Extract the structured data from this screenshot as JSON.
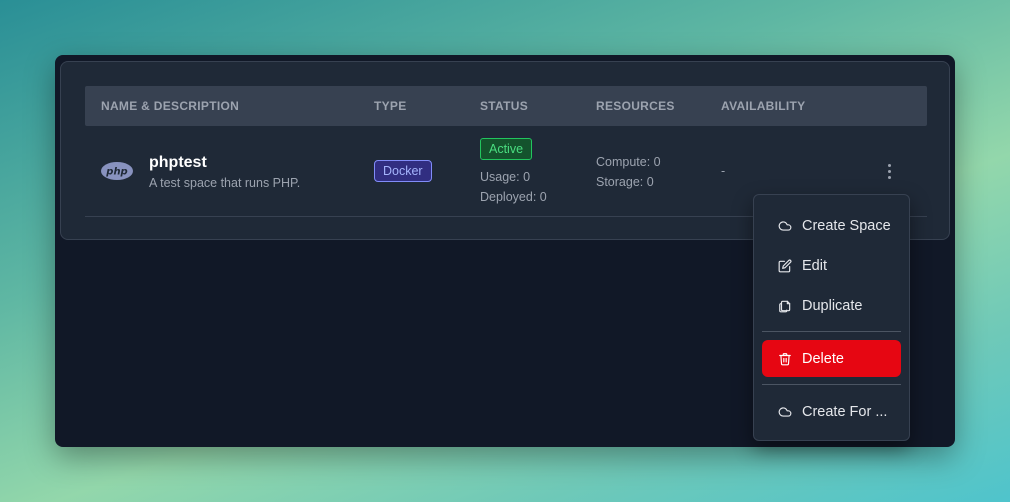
{
  "table": {
    "columns": [
      "NAME & DESCRIPTION",
      "TYPE",
      "STATUS",
      "RESOURCES",
      "AVAILABILITY"
    ],
    "rows": [
      {
        "logo_text": "php",
        "name": "phptest",
        "description": "A test space that runs PHP.",
        "type": "Docker",
        "status": "Active",
        "usage": "Usage: 0",
        "deployed": "Deployed: 0",
        "compute": "Compute: 0",
        "storage": "Storage: 0",
        "availability": "-"
      }
    ]
  },
  "context_menu": {
    "items": [
      {
        "label": "Create Space",
        "icon": "cloud-icon"
      },
      {
        "label": "Edit",
        "icon": "edit-icon"
      },
      {
        "label": "Duplicate",
        "icon": "copy-icon"
      },
      {
        "label": "Delete",
        "icon": "trash-icon",
        "danger": true
      },
      {
        "label": "Create For ...",
        "icon": "cloud-icon"
      }
    ]
  },
  "colors": {
    "window_bg": "#111827",
    "card_bg": "#1f2937",
    "header_bg": "#374151",
    "status_active": "#4ade80",
    "type_badge": "#a5b4fc",
    "danger": "#e60612"
  }
}
